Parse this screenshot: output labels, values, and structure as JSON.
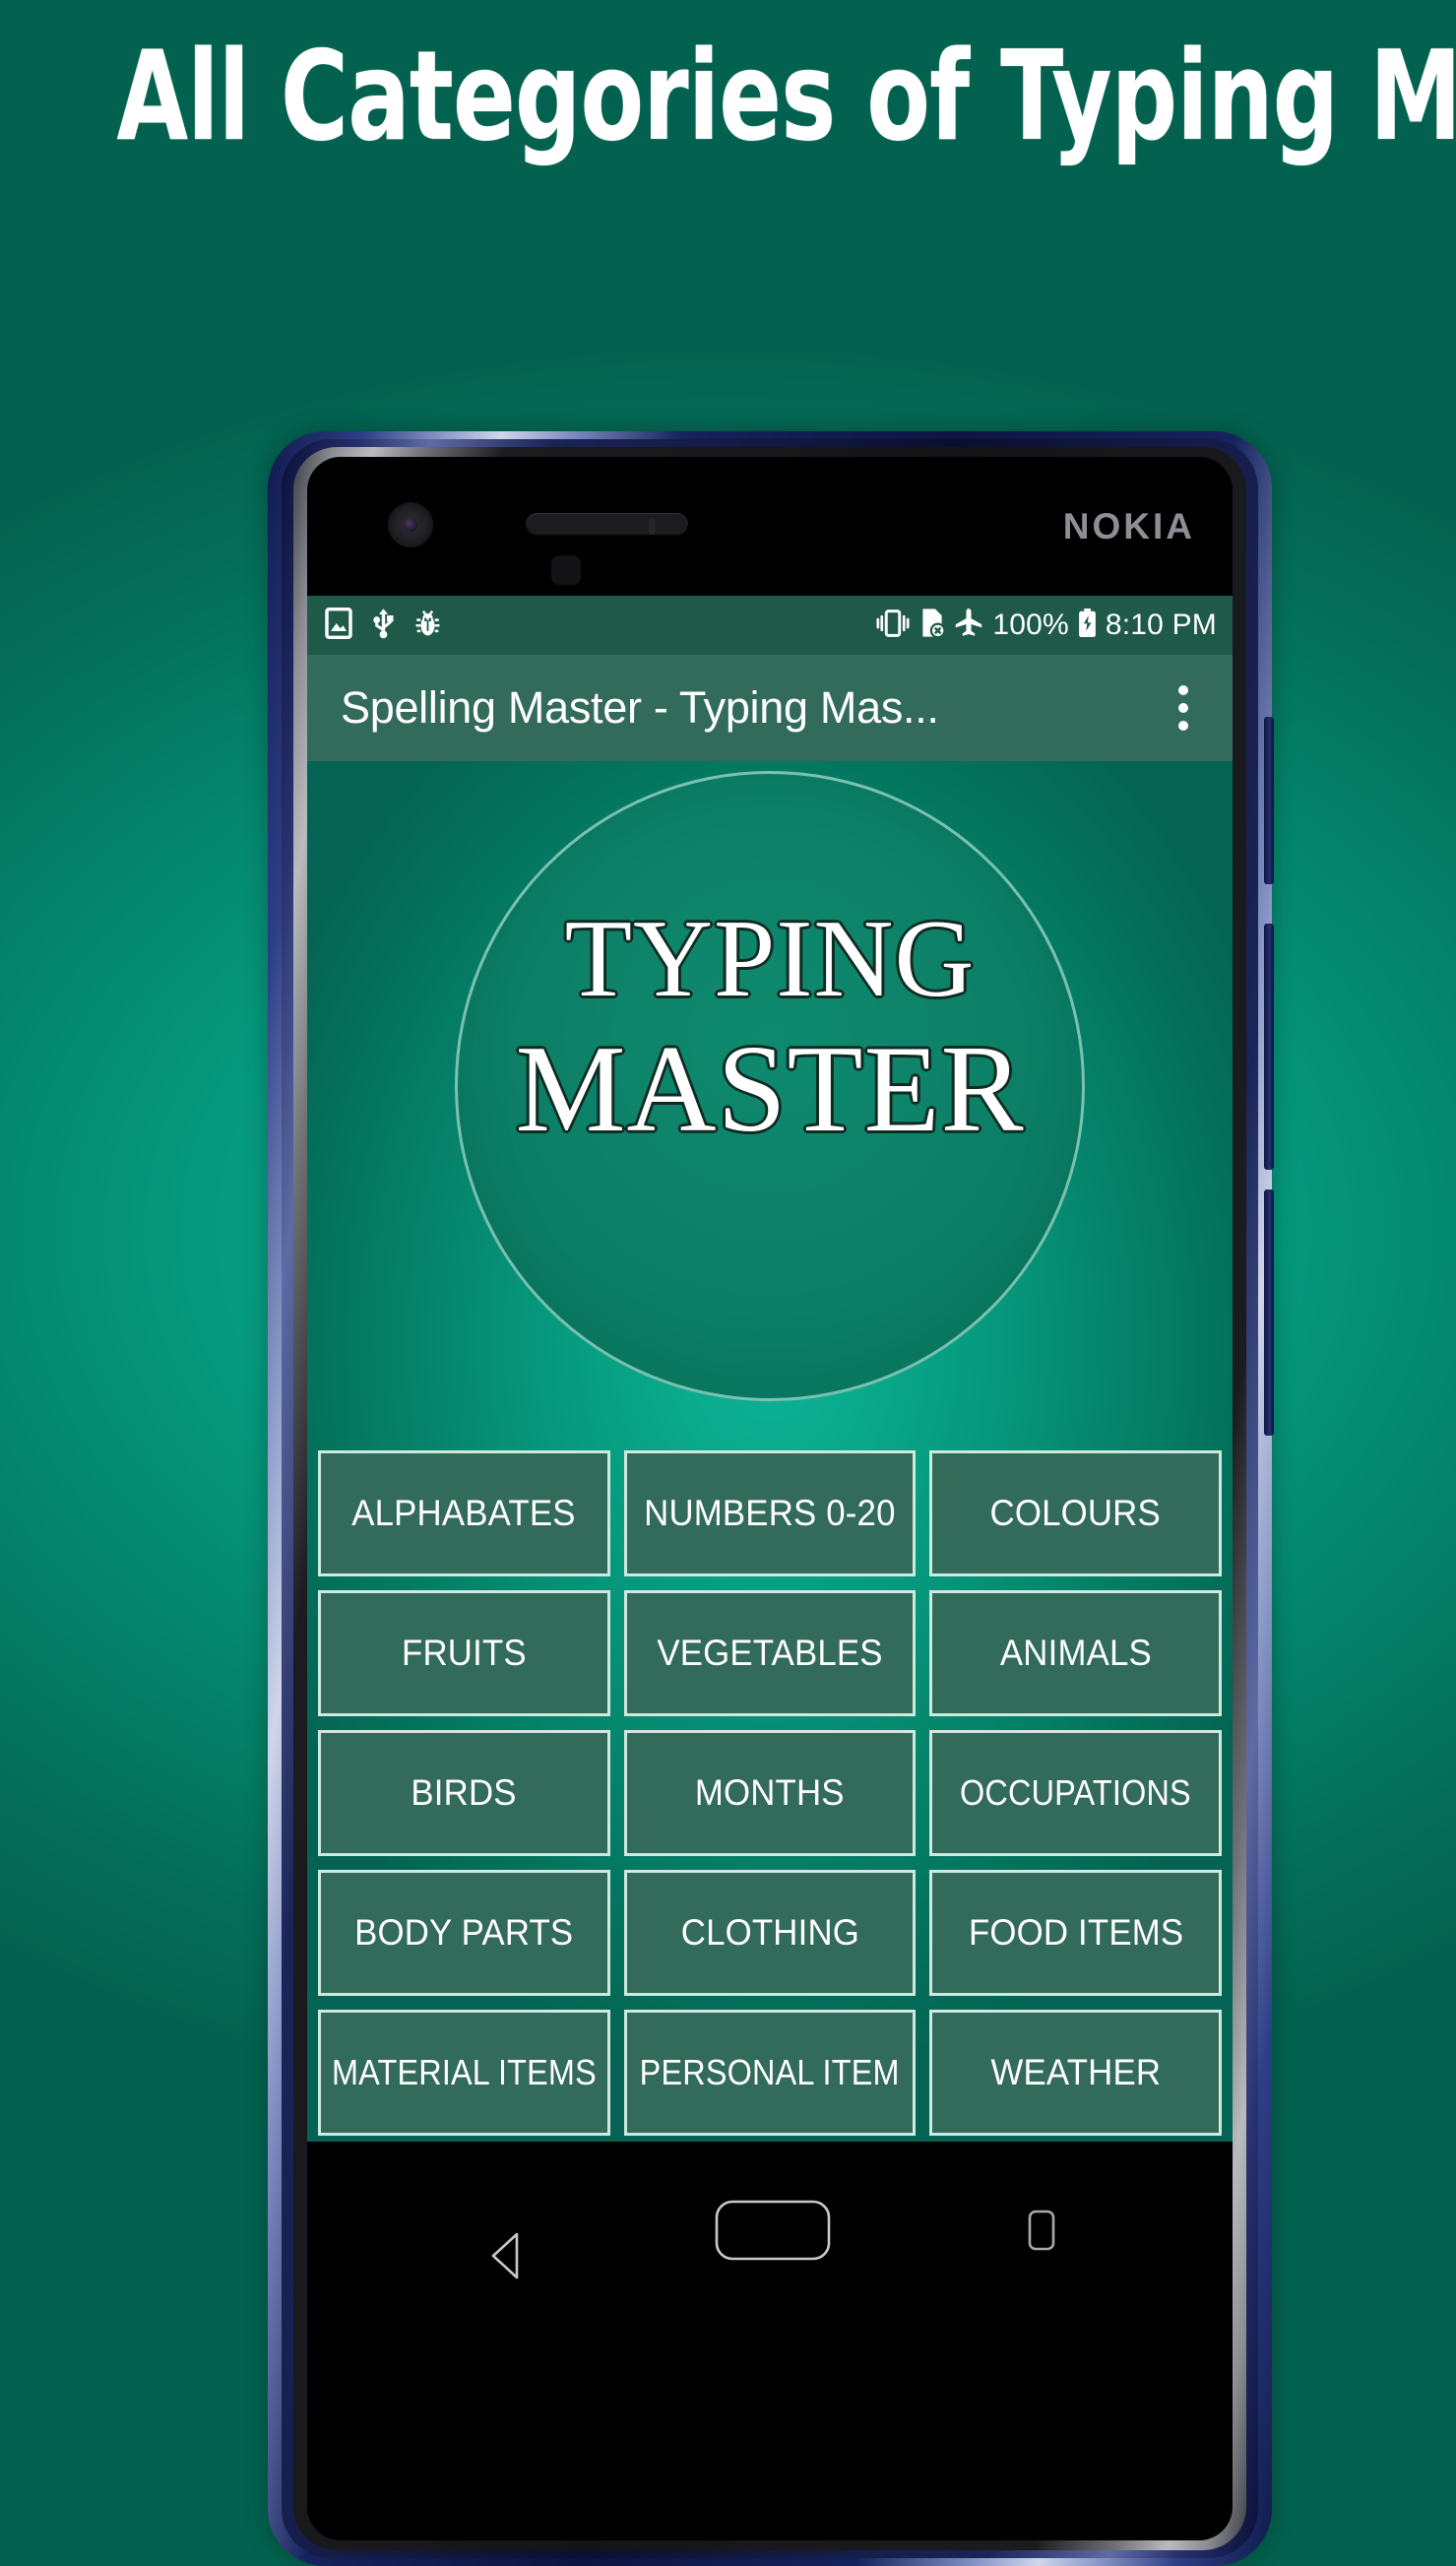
{
  "hero": {
    "title": "All Categories of Typing Master"
  },
  "colors": {
    "background_top": "#03805E",
    "background_center": "#0BB394",
    "background_bottom": "#046352",
    "action_bar": "#336B5A",
    "status_bar": "#1F5A48",
    "button_fill": "#336B5A",
    "button_border": "#CFE9E0",
    "text_on_dark": "#FFFFFF",
    "nokia_logo": "#8D8F94"
  },
  "device": {
    "brand": "NOKIA",
    "front_camera": "front-camera",
    "earpiece": "earpiece-speaker",
    "proximity_sensor": "proximity-sensor"
  },
  "status_bar": {
    "left_icons": [
      {
        "name": "image-icon",
        "glyph": "image"
      },
      {
        "name": "usb-icon",
        "glyph": "usb"
      },
      {
        "name": "bug-icon",
        "glyph": "bug"
      }
    ],
    "right_icons": [
      {
        "name": "vibrate-icon",
        "glyph": "vibrate"
      },
      {
        "name": "sim-card-off-icon",
        "glyph": "sim-off"
      },
      {
        "name": "airplane-mode-icon",
        "glyph": "airplane"
      }
    ],
    "battery_percent": "100%",
    "battery_icon": "battery-charging-icon",
    "time": "8:10 PM"
  },
  "action_bar": {
    "title": "Spelling Master - Typing Mas...",
    "overflow_menu": "overflow-menu"
  },
  "logo": {
    "line1": "TYPING",
    "line2": "MASTER"
  },
  "categories": [
    {
      "label": "ALPHABATES",
      "tight": false
    },
    {
      "label": "NUMBERS 0-20",
      "tight": false
    },
    {
      "label": "COLOURS",
      "tight": false
    },
    {
      "label": "FRUITS",
      "tight": false
    },
    {
      "label": "VEGETABLES",
      "tight": false
    },
    {
      "label": "ANIMALS",
      "tight": false
    },
    {
      "label": "BIRDS",
      "tight": false
    },
    {
      "label": "MONTHS",
      "tight": false
    },
    {
      "label": "OCCUPATIONS",
      "tight": true
    },
    {
      "label": "BODY PARTS",
      "tight": false
    },
    {
      "label": "CLOTHING",
      "tight": false
    },
    {
      "label": "FOOD ITEMS",
      "tight": false
    },
    {
      "label": "MATERIAL ITEMS",
      "tight": true
    },
    {
      "label": "PERSONAL ITEM",
      "tight": true
    },
    {
      "label": "WEATHER",
      "tight": false
    }
  ],
  "navigation_bar": {
    "back": "back-button",
    "home": "home-button",
    "recents": "recents-button"
  }
}
